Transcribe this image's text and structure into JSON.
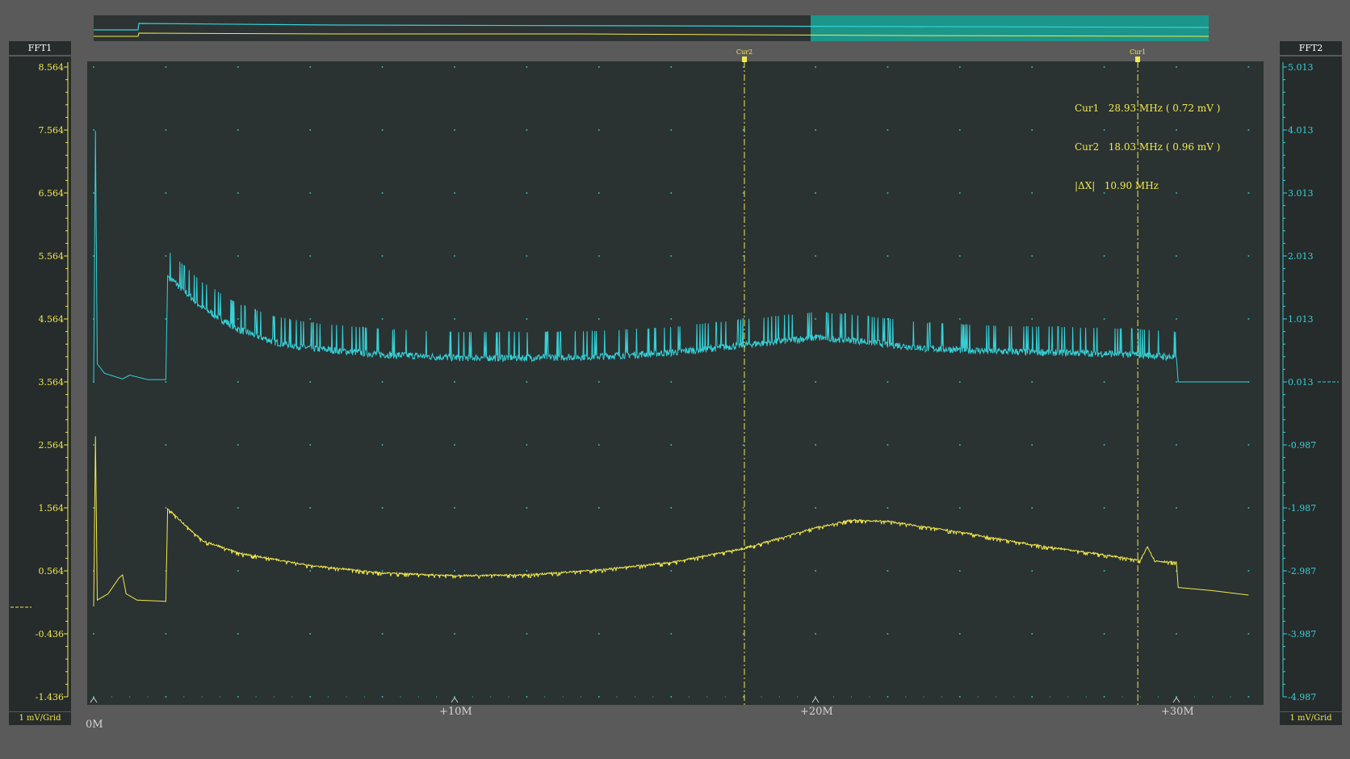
{
  "panels": {
    "left": {
      "title": "FFT1",
      "grid": "1 mV/Grid",
      "color": "#f2e94e",
      "ticks": [
        "8.564",
        "7.564",
        "6.564",
        "5.564",
        "4.564",
        "3.564",
        "2.564",
        "1.564",
        "0.564",
        "-0.436",
        "-1.436"
      ]
    },
    "right": {
      "title": "FFT2",
      "grid": "1 mV/Grid",
      "color": "#35d2d8",
      "ticks": [
        "5.013",
        "4.013",
        "3.013",
        "2.013",
        "1.013",
        "0.013",
        "-0.987",
        "-1.987",
        "-2.987",
        "-3.987",
        "-4.987"
      ]
    }
  },
  "x_axis": {
    "labels": [
      "0M",
      "+10M",
      "+20M",
      "+30M"
    ]
  },
  "cursors": {
    "cur1": {
      "tag": "Cur1",
      "name": "Cur1",
      "freq": "28.93 MHz",
      "value": "( 0.72 mV )",
      "x_mhz": 28.93
    },
    "cur2": {
      "tag": "Cur2",
      "name": "Cur2",
      "freq": "18.03 MHz",
      "value": "( 0.96 mV )",
      "x_mhz": 18.03
    },
    "delta": {
      "name": "|ΔX|",
      "value": "10.90 MHz"
    }
  },
  "overview": {
    "highlight_color": "#1aa89a"
  },
  "chart_data": {
    "type": "line",
    "xlim": [
      0,
      32
    ],
    "series": [
      {
        "name": "FFT2",
        "color": "#35d2d8",
        "x": [
          0,
          0.05,
          0.1,
          0.3,
          0.8,
          1.0,
          1.5,
          2.0,
          2.05,
          3,
          4,
          5,
          6,
          8,
          10,
          12,
          14,
          16,
          18,
          20,
          21,
          23,
          25,
          27,
          29,
          30,
          30.05,
          31,
          32
        ],
        "y": [
          0.0,
          4.0,
          0.3,
          0.15,
          0.06,
          0.12,
          0.05,
          0.05,
          1.7,
          1.2,
          0.85,
          0.65,
          0.55,
          0.45,
          0.4,
          0.4,
          0.42,
          0.48,
          0.6,
          0.72,
          0.68,
          0.55,
          0.5,
          0.48,
          0.45,
          0.4,
          0.013,
          0.013,
          0.013
        ]
      },
      {
        "name": "FFT1",
        "color": "#f2e94e",
        "x": [
          0,
          0.05,
          0.1,
          0.4,
          0.7,
          0.8,
          0.9,
          1.2,
          2.0,
          2.05,
          3,
          4,
          6,
          8,
          10,
          12,
          14,
          16,
          18,
          19,
          20,
          21,
          22,
          24,
          26,
          28,
          29,
          29.2,
          29.4,
          30,
          30.05,
          31,
          32
        ],
        "y": [
          0.0,
          2.7,
          0.1,
          0.2,
          0.45,
          0.5,
          0.2,
          0.1,
          0.08,
          1.55,
          1.05,
          0.85,
          0.65,
          0.53,
          0.49,
          0.5,
          0.58,
          0.7,
          0.92,
          1.08,
          1.25,
          1.37,
          1.35,
          1.18,
          0.98,
          0.82,
          0.73,
          0.95,
          0.72,
          0.7,
          0.3,
          0.25,
          0.18
        ]
      }
    ]
  }
}
